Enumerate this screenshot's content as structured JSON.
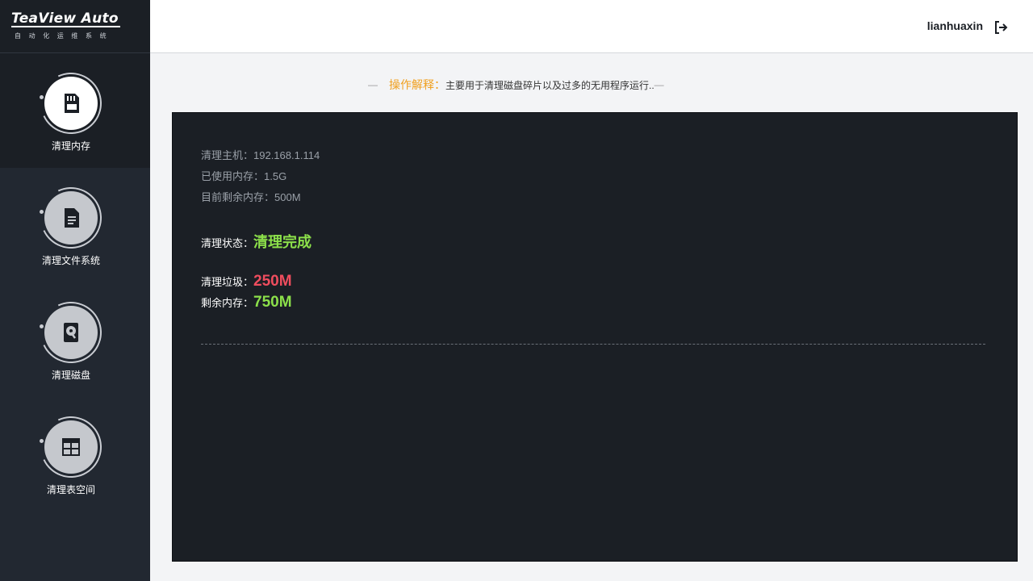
{
  "app": {
    "logo": "TeaView Auto",
    "logo_sub": "自动化运维系统"
  },
  "header": {
    "username": "lianhuaxin"
  },
  "sidebar": {
    "items": [
      {
        "label": "清理内存",
        "icon": "memory-card-icon",
        "active": true
      },
      {
        "label": "清理文件系统",
        "icon": "document-icon",
        "active": false
      },
      {
        "label": "清理磁盘",
        "icon": "hard-disk-icon",
        "active": false
      },
      {
        "label": "清理表空间",
        "icon": "table-icon",
        "active": false
      }
    ]
  },
  "hint": {
    "title": "操作解释：",
    "text": "主要用于清理磁盘碎片以及过多的无用程序运行.."
  },
  "panel": {
    "host": "清理主机：192.168.1.114",
    "used_memory": "已使用内存：1.5G",
    "free_memory": "目前剩余内存：500M",
    "status_label": "清理状态：",
    "status_value": "清理完成",
    "junk_label": "清理垃圾：",
    "junk_value": "250M",
    "remain_label": "剩余内存：",
    "remain_value": "750M"
  },
  "colors": {
    "sidebar_bg": "#222831",
    "panel_bg": "#1b1f25",
    "accent_orange": "#f0a020",
    "success_green": "#8ce04a",
    "danger_red": "#ef4d5e"
  }
}
